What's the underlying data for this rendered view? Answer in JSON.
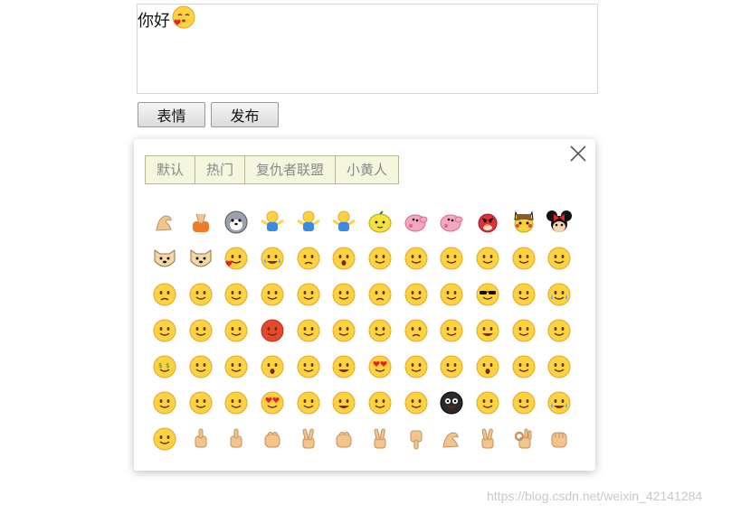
{
  "editor": {
    "text": "你好",
    "inserted_emoji_icon": "kiss-heart-face-icon"
  },
  "buttons": {
    "emoji_label": "表情",
    "publish_label": "发布"
  },
  "panel": {
    "tabs": [
      {
        "label": "默认"
      },
      {
        "label": "热门"
      },
      {
        "label": "复仇者联盟"
      },
      {
        "label": "小黄人"
      }
    ],
    "close_icon": "close-icon",
    "emoji_rows": [
      [
        "muscle-arm-icon",
        "praying-hands-icon",
        "husky-dog-icon",
        "hugging-figure-icon",
        "hugging-figure-2-icon",
        "sitting-figure-icon",
        "lemon-face-icon",
        "peppa-pig-icon",
        "peppa-pig-2-icon",
        "angry-bird-icon",
        "pikachu-detective-icon",
        "minnie-mouse-icon"
      ],
      [
        "cat-face-icon",
        "doge-face-icon",
        "kiss-heart-face-icon",
        "laugh-cry-face-icon",
        "sad-face-icon",
        "shocked-face-icon",
        "covered-eyes-face-icon",
        "confused-face-icon",
        "wink-face-icon",
        "relaxed-sign-face-icon",
        "thinking-face-icon",
        "glasses-face-icon"
      ],
      [
        "angry-face-icon",
        "taped-mouth-face-icon",
        "tongue-face-icon",
        "drooling-face-icon",
        "worried-face-icon",
        "clapping-face-icon",
        "crying-face-icon",
        "hammer-face-icon",
        "sweating-face-icon",
        "sunglasses-face-icon",
        "shy-face-icon",
        "tears-face-icon"
      ],
      [
        "sleepy-face-icon",
        "smirk-face-icon",
        "smile-face-icon",
        "furious-face-icon",
        "blushing-face-icon",
        "sweat-drop-face-icon",
        "pleading-face-icon",
        "mad-face-icon",
        "bruised-face-icon",
        "grin-face-icon",
        "dizzy-face-icon",
        "eye-roll-face-icon"
      ],
      [
        "money-face-icon",
        "whistle-face-icon",
        "sick-face-icon",
        "yawning-face-icon",
        "sneer-face-icon",
        "big-grin-face-icon",
        "heart-eyes-face-icon",
        "mask-face-icon",
        "cold-sweat-face-icon",
        "surprised-face-icon",
        "meh-face-icon",
        "vomit-face-icon"
      ],
      [
        "thinking-hand-face-icon",
        "happy-face-icon",
        "shy-hands-face-icon",
        "love-face-icon",
        "sleep-face-icon",
        "toothy-grin-face-icon",
        "pleased-face-icon",
        "embarrassed-face-icon",
        "black-ball-face-icon",
        "shhh-face-icon",
        "facepalm-face-icon",
        "tears-of-joy-face-icon"
      ],
      [
        "smug-face-icon",
        "thumbs-up-icon",
        "thumbs-up-2-icon",
        "pinch-fingers-icon",
        "victory-hand-icon",
        "pray-hands-icon",
        "rock-horns-icon",
        "thumbs-down-icon",
        "flexed-bicep-icon",
        "peace-hand-icon",
        "ok-hand-icon",
        "fist-icon"
      ]
    ]
  },
  "watermark": "https://blog.csdn.net/weixin_42141284",
  "colors": {
    "face": "#ffd23f",
    "face_edge": "#e2a52a",
    "hand": "#f2c58f",
    "hand_edge": "#c8905a",
    "red_face": "#e8482a",
    "dark": "#2a2a2a"
  }
}
